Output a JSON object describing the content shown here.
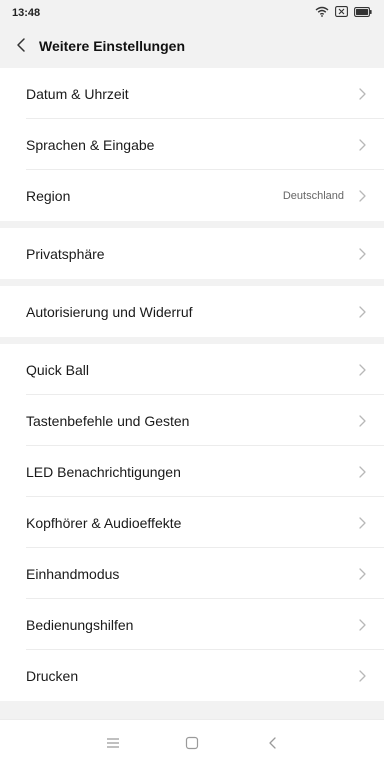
{
  "status_bar": {
    "time": "13:48",
    "icons": [
      "wifi-icon",
      "sim-card-icon",
      "battery-icon"
    ]
  },
  "header": {
    "back_icon": "chevron-left-icon",
    "title": "Weitere Einstellungen"
  },
  "groups": [
    {
      "items": [
        {
          "label": "Datum & Uhrzeit",
          "value": ""
        },
        {
          "label": "Sprachen & Eingabe",
          "value": ""
        },
        {
          "label": "Region",
          "value": "Deutschland"
        }
      ]
    },
    {
      "items": [
        {
          "label": "Privatsphäre",
          "value": ""
        }
      ]
    },
    {
      "items": [
        {
          "label": "Autorisierung und Widerruf",
          "value": ""
        }
      ]
    },
    {
      "items": [
        {
          "label": "Quick Ball",
          "value": ""
        },
        {
          "label": "Tastenbefehle und Gesten",
          "value": ""
        },
        {
          "label": "LED Benachrichtigungen",
          "value": ""
        },
        {
          "label": "Kopfhörer & Audioeffekte",
          "value": ""
        },
        {
          "label": "Einhandmodus",
          "value": ""
        },
        {
          "label": "Bedienungshilfen",
          "value": ""
        },
        {
          "label": "Drucken",
          "value": ""
        }
      ]
    }
  ],
  "nav_bar": {
    "icons": [
      "menu-icon",
      "home-icon",
      "back-icon"
    ]
  },
  "colors": {
    "background": "#f2f2f2",
    "surface": "#ffffff",
    "divider": "#ececec",
    "text": "#1a1a1a",
    "chevron": "#b8b8b8"
  }
}
